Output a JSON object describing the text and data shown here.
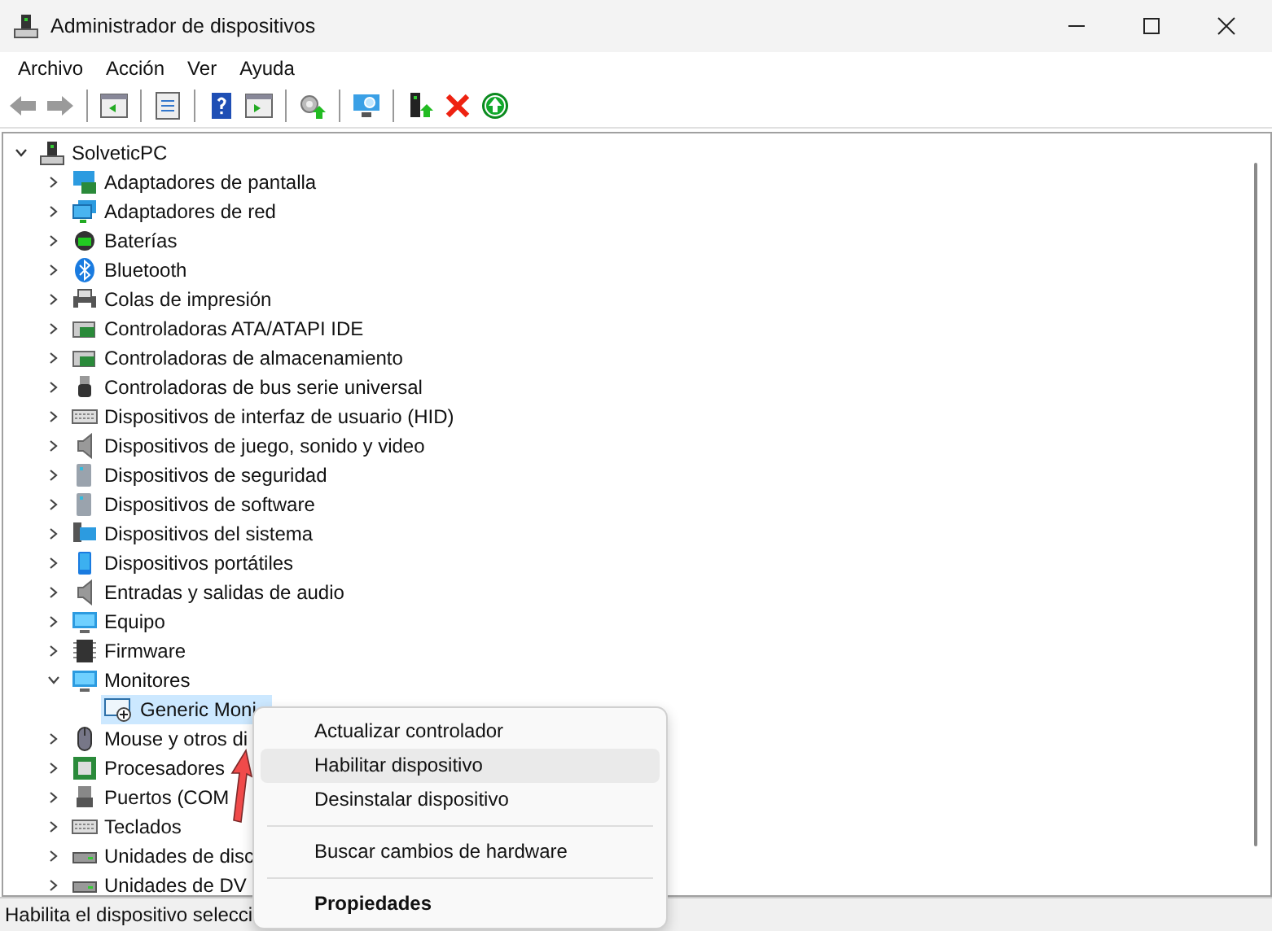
{
  "window": {
    "title": "Administrador de dispositivos"
  },
  "menu_bar": [
    "Archivo",
    "Acción",
    "Ver",
    "Ayuda"
  ],
  "toolbar": [
    {
      "kind": "back",
      "disabled": true
    },
    {
      "kind": "forward",
      "disabled": true
    },
    {
      "kind": "separator"
    },
    {
      "kind": "tree"
    },
    {
      "kind": "separator"
    },
    {
      "kind": "properties"
    },
    {
      "kind": "separator"
    },
    {
      "kind": "help"
    },
    {
      "kind": "pane"
    },
    {
      "kind": "separator"
    },
    {
      "kind": "update"
    },
    {
      "kind": "separator"
    },
    {
      "kind": "scan"
    },
    {
      "kind": "separator"
    },
    {
      "kind": "add"
    },
    {
      "kind": "remove"
    },
    {
      "kind": "enable"
    }
  ],
  "tree": {
    "label": "SolveticPC",
    "expanded": true,
    "children": [
      {
        "label": "Adaptadores de pantalla",
        "expanded": false
      },
      {
        "label": "Adaptadores de red",
        "expanded": false
      },
      {
        "label": "Baterías",
        "expanded": false
      },
      {
        "label": "Bluetooth",
        "expanded": false
      },
      {
        "label": "Colas de impresión",
        "expanded": false
      },
      {
        "label": "Controladoras ATA/ATAPI IDE",
        "expanded": false
      },
      {
        "label": "Controladoras de almacenamiento",
        "expanded": false
      },
      {
        "label": "Controladoras de bus serie universal",
        "expanded": false
      },
      {
        "label": "Dispositivos de interfaz de usuario (HID)",
        "expanded": false
      },
      {
        "label": "Dispositivos de juego, sonido y video",
        "expanded": false
      },
      {
        "label": "Dispositivos de seguridad",
        "expanded": false
      },
      {
        "label": "Dispositivos de software",
        "expanded": false
      },
      {
        "label": "Dispositivos del sistema",
        "expanded": false
      },
      {
        "label": "Dispositivos portátiles",
        "expanded": false
      },
      {
        "label": "Entradas y salidas de audio",
        "expanded": false
      },
      {
        "label": "Equipo",
        "expanded": false
      },
      {
        "label": "Firmware",
        "expanded": false
      },
      {
        "label": "Monitores",
        "expanded": true,
        "children": [
          {
            "label": "Generic Moni",
            "selected": true
          }
        ]
      },
      {
        "label": "Mouse y otros di",
        "expanded": false
      },
      {
        "label": "Procesadores",
        "expanded": false
      },
      {
        "label": "Puertos (COM",
        "expanded": false
      },
      {
        "label": "Teclados",
        "expanded": false
      },
      {
        "label": "Unidades de disc",
        "expanded": false
      },
      {
        "label": "Unidades de DV",
        "expanded": false
      }
    ]
  },
  "context_menu": [
    {
      "kind": "item",
      "label": "Actualizar controlador",
      "selected": false
    },
    {
      "kind": "item",
      "label": "Habilitar dispositivo",
      "selected": true
    },
    {
      "kind": "item",
      "label": "Desinstalar dispositivo",
      "selected": false
    },
    {
      "kind": "separator"
    },
    {
      "kind": "item",
      "label": "Buscar cambios de hardware",
      "selected": false
    },
    {
      "kind": "separator"
    },
    {
      "kind": "default",
      "label": "Propiedades",
      "selected": false
    }
  ],
  "status_bar": "Habilita el dispositivo selecci"
}
